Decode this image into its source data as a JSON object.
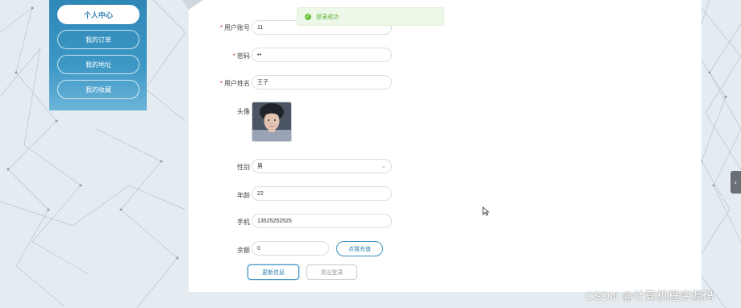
{
  "sidebar": {
    "items": [
      {
        "label": "个人中心"
      },
      {
        "label": "我的订单"
      },
      {
        "label": "我的地址"
      },
      {
        "label": "我的收藏"
      }
    ]
  },
  "toast": {
    "message": "登录成功"
  },
  "form": {
    "account": {
      "label": "用户账号",
      "value": "11"
    },
    "password": {
      "label": "密码",
      "value": "••"
    },
    "name": {
      "label": "用户姓名",
      "value": "王子"
    },
    "avatar": {
      "label": "头像"
    },
    "gender": {
      "label": "性别",
      "value": "男"
    },
    "age": {
      "label": "年龄",
      "value": "22"
    },
    "phone": {
      "label": "手机",
      "value": "13525252525"
    },
    "balance": {
      "label": "余额",
      "value": "0"
    }
  },
  "buttons": {
    "recharge": "点我充值",
    "update": "更新信息",
    "logout": "退出登录"
  },
  "watermark": "CSDN @计算机程序源码",
  "colors": {
    "primary": "#2f87b6",
    "success": "#67c23a",
    "required": "#e2342f"
  }
}
